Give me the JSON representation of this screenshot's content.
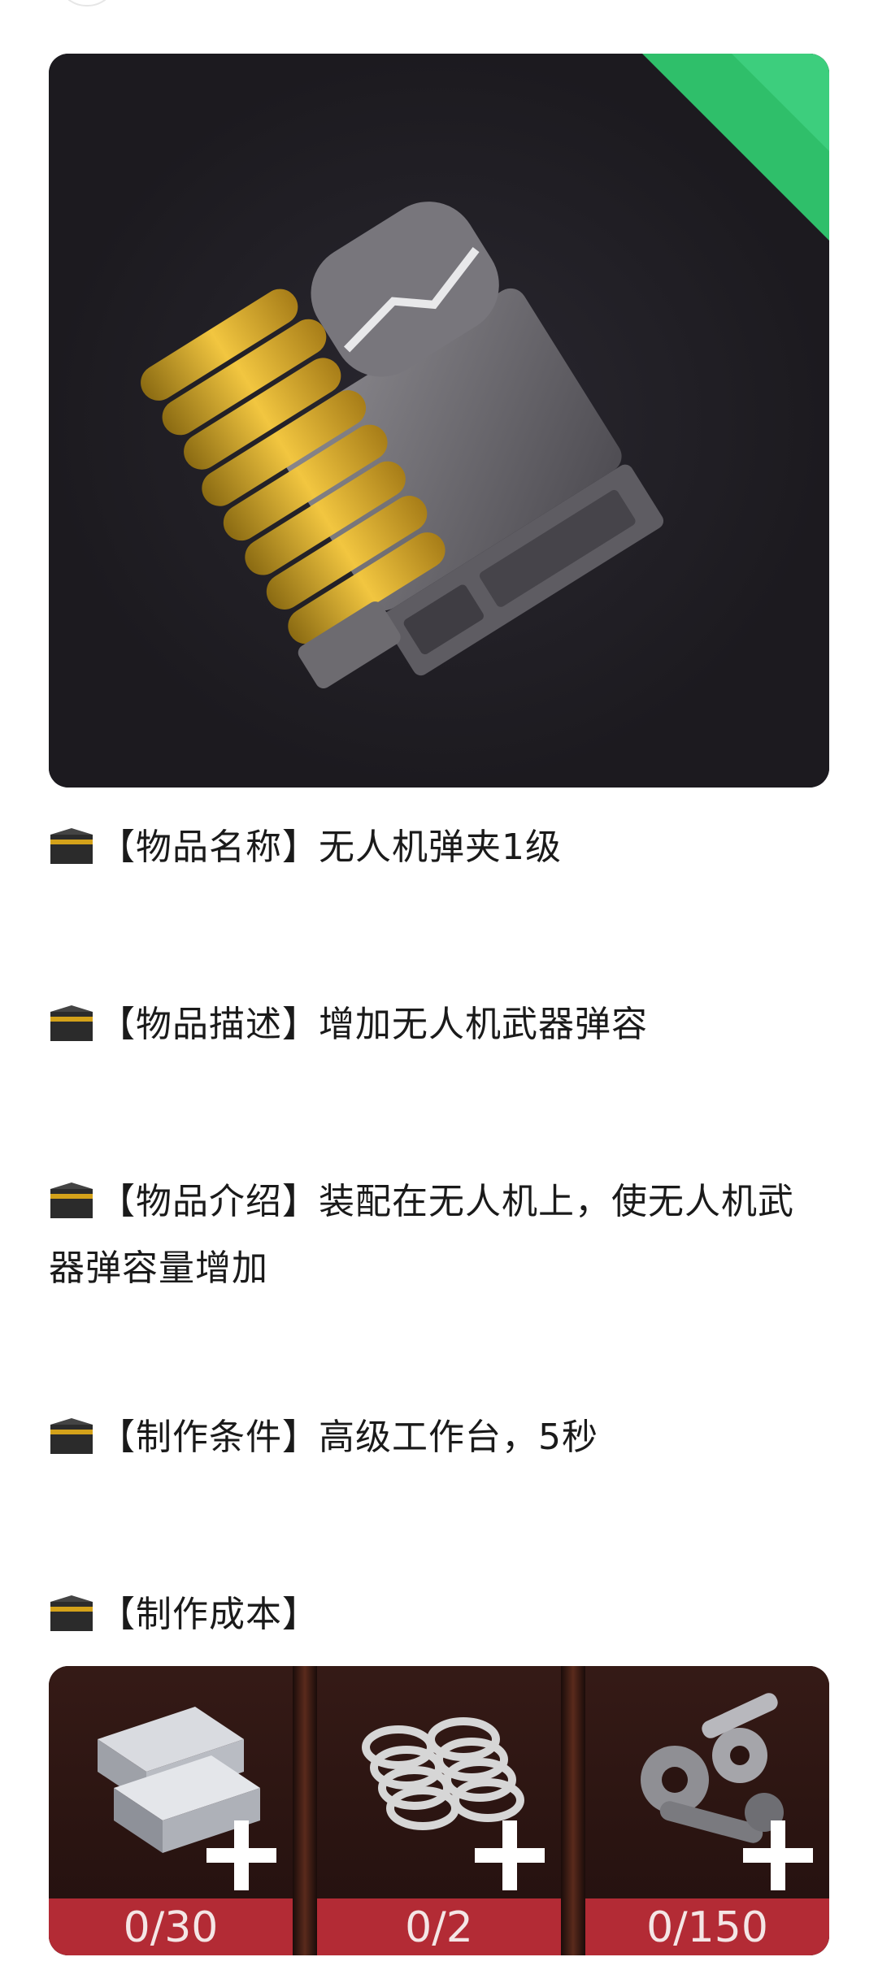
{
  "item": {
    "name_line": "【物品名称】无人机弹夹1级",
    "desc_line": "【物品描述】增加无人机武器弹容",
    "intro_line": "【物品介绍】装配在无人机上，使无人机武器弹容量增加",
    "craft_cond_line": "【制作条件】高级工作台，5秒",
    "craft_cost_line": "【制作成本】"
  },
  "materials": [
    {
      "icon": "metal-ingot-icon",
      "amount": "0/30"
    },
    {
      "icon": "spring-icon",
      "amount": "0/2"
    },
    {
      "icon": "gear-parts-icon",
      "amount": "0/150"
    }
  ],
  "colors": {
    "corner_badge": "#2fbf6a",
    "cost_label": "#b32b35",
    "hero_bg": "#1f1d22"
  }
}
